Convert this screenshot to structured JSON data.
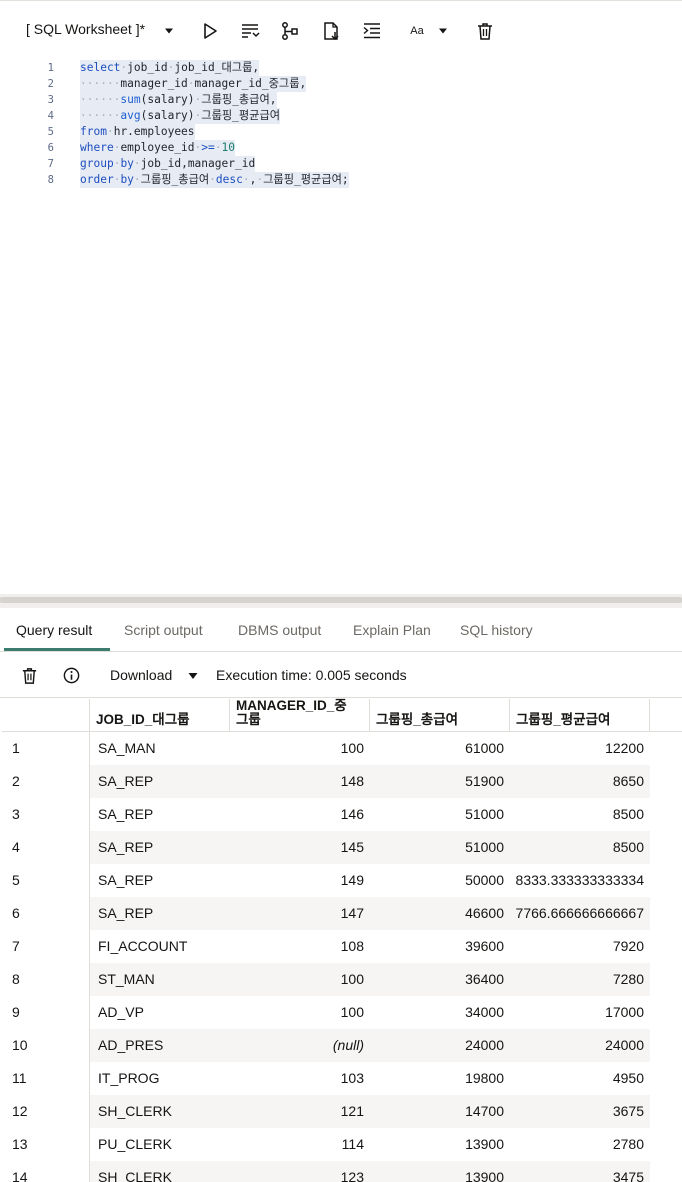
{
  "worksheet": {
    "title": "[ SQL Worksheet ]*",
    "toolbar_icons": [
      "chevron-down-icon",
      "run-icon",
      "format-icon",
      "explain-icon",
      "download-file-icon",
      "indent-icon",
      "font-size-icon",
      "delete-icon"
    ],
    "font_size_label": "Aa",
    "code_lines": [
      {
        "n": "1",
        "parts": [
          [
            "kw",
            "select"
          ],
          [
            "dots",
            "·"
          ],
          [
            "ident",
            "job_id"
          ],
          [
            "dots",
            "·"
          ],
          [
            "ident",
            "job_id_대그룹,"
          ]
        ]
      },
      {
        "n": "2",
        "parts": [
          [
            "dots",
            "······"
          ],
          [
            "ident",
            "manager_id"
          ],
          [
            "dots",
            "·"
          ],
          [
            "ident",
            "manager_id_중그룹,"
          ]
        ]
      },
      {
        "n": "3",
        "parts": [
          [
            "dots",
            "······"
          ],
          [
            "fn",
            "sum"
          ],
          [
            "ident",
            "(salary)"
          ],
          [
            "dots",
            "·"
          ],
          [
            "ident",
            "그룹핑_총급여,"
          ]
        ]
      },
      {
        "n": "4",
        "parts": [
          [
            "dots",
            "······"
          ],
          [
            "fn",
            "avg"
          ],
          [
            "ident",
            "(salary)"
          ],
          [
            "dots",
            "·"
          ],
          [
            "ident",
            "그룹핑_평균급여"
          ]
        ]
      },
      {
        "n": "5",
        "parts": [
          [
            "kw",
            "from"
          ],
          [
            "dots",
            "·"
          ],
          [
            "ident",
            "hr.employees"
          ]
        ]
      },
      {
        "n": "6",
        "parts": [
          [
            "kw",
            "where"
          ],
          [
            "dots",
            "·"
          ],
          [
            "ident",
            "employee_id"
          ],
          [
            "dots",
            "·"
          ],
          [
            "op",
            ">="
          ],
          [
            "dots",
            "·"
          ],
          [
            "num",
            "10"
          ]
        ]
      },
      {
        "n": "7",
        "parts": [
          [
            "kw",
            "group"
          ],
          [
            "dots",
            "·"
          ],
          [
            "kw",
            "by"
          ],
          [
            "dots",
            "·"
          ],
          [
            "ident",
            "job_id,manager_id"
          ]
        ]
      },
      {
        "n": "8",
        "parts": [
          [
            "kw",
            "order"
          ],
          [
            "dots",
            "·"
          ],
          [
            "kw",
            "by"
          ],
          [
            "dots",
            "·"
          ],
          [
            "ident",
            "그룹핑_총급여"
          ],
          [
            "dots",
            "·"
          ],
          [
            "kw",
            "desc"
          ],
          [
            "dots",
            "·"
          ],
          [
            "ident",
            ","
          ],
          [
            "dots",
            "·"
          ],
          [
            "ident",
            "그룹핑_평균급여;"
          ]
        ]
      }
    ]
  },
  "results": {
    "tabs": [
      "Query result",
      "Script output",
      "DBMS output",
      "Explain Plan",
      "SQL history"
    ],
    "active_tab": "Query result",
    "download_label": "Download",
    "execution_time": "Execution time: 0.005 seconds",
    "columns": [
      "JOB_ID_대그룹",
      "MANAGER_ID_중그룹",
      "그룹핑_총급여",
      "그룹핑_평균급여"
    ],
    "rows": [
      {
        "n": "1",
        "job": "SA_MAN",
        "mgr": "100",
        "tot": "61000",
        "avg": "12200"
      },
      {
        "n": "2",
        "job": "SA_REP",
        "mgr": "148",
        "tot": "51900",
        "avg": "8650"
      },
      {
        "n": "3",
        "job": "SA_REP",
        "mgr": "146",
        "tot": "51000",
        "avg": "8500"
      },
      {
        "n": "4",
        "job": "SA_REP",
        "mgr": "145",
        "tot": "51000",
        "avg": "8500"
      },
      {
        "n": "5",
        "job": "SA_REP",
        "mgr": "149",
        "tot": "50000",
        "avg": "8333.333333333334"
      },
      {
        "n": "6",
        "job": "SA_REP",
        "mgr": "147",
        "tot": "46600",
        "avg": "7766.666666666667"
      },
      {
        "n": "7",
        "job": "FI_ACCOUNT",
        "mgr": "108",
        "tot": "39600",
        "avg": "7920"
      },
      {
        "n": "8",
        "job": "ST_MAN",
        "mgr": "100",
        "tot": "36400",
        "avg": "7280"
      },
      {
        "n": "9",
        "job": "AD_VP",
        "mgr": "100",
        "tot": "34000",
        "avg": "17000"
      },
      {
        "n": "10",
        "job": "AD_PRES",
        "mgr": "(null)",
        "tot": "24000",
        "avg": "24000"
      },
      {
        "n": "11",
        "job": "IT_PROG",
        "mgr": "103",
        "tot": "19800",
        "avg": "4950"
      },
      {
        "n": "12",
        "job": "SH_CLERK",
        "mgr": "121",
        "tot": "14700",
        "avg": "3675"
      },
      {
        "n": "13",
        "job": "PU_CLERK",
        "mgr": "114",
        "tot": "13900",
        "avg": "2780"
      },
      {
        "n": "14",
        "job": "SH_CLERK",
        "mgr": "123",
        "tot": "13900",
        "avg": "3475"
      }
    ]
  }
}
